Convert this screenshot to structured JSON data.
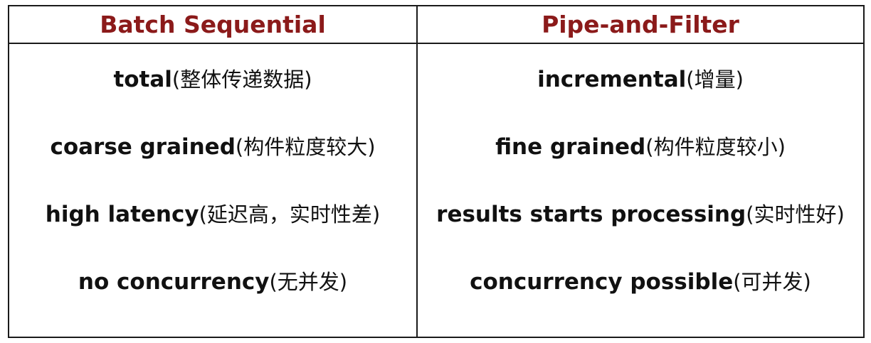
{
  "table": {
    "headers": {
      "left": "Batch Sequential",
      "right": "Pipe-and-Filter"
    },
    "left_items": [
      {
        "en": "total",
        "cn": "(整体传递数据)"
      },
      {
        "en": "coarse grained",
        "cn": "(构件粒度较大)"
      },
      {
        "en": "high latency ",
        "cn": "(延迟高，实时性差)"
      },
      {
        "en": "no concurrency ",
        "cn": "(无并发)"
      }
    ],
    "right_items": [
      {
        "en": "incremental",
        "cn": "(增量)"
      },
      {
        "en": "fine grained ",
        "cn": "(构件粒度较小)"
      },
      {
        "en": "results starts processing ",
        "cn": "(实时性好)"
      },
      {
        "en": "concurrency possible ",
        "cn": "(可并发)"
      }
    ],
    "header_color": "#8b1a1a",
    "border_color": "#1a1a1a"
  }
}
